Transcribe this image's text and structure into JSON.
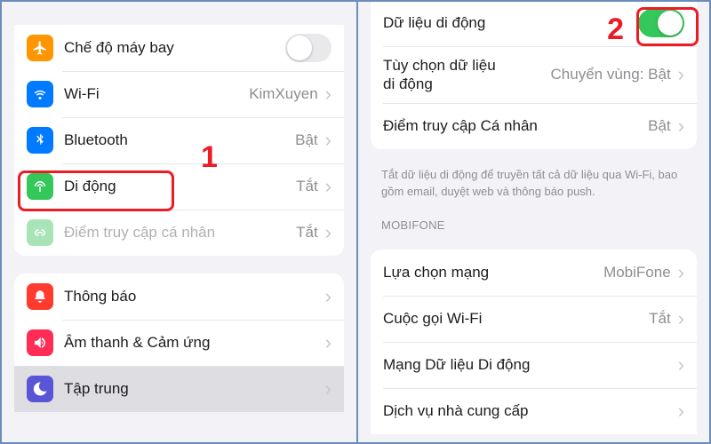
{
  "left": {
    "group1": [
      {
        "id": "airplane",
        "label": "Chế độ máy bay",
        "value": null,
        "toggle": "off",
        "chevron": false
      },
      {
        "id": "wifi",
        "label": "Wi-Fi",
        "value": "KimXuyen",
        "chevron": true
      },
      {
        "id": "bluetooth",
        "label": "Bluetooth",
        "value": "Bật",
        "chevron": true
      },
      {
        "id": "cellular",
        "label": "Di động",
        "value": "Tắt",
        "chevron": true
      },
      {
        "id": "hotspot",
        "label": "Điểm truy cập cá nhân",
        "value": "Tắt",
        "chevron": true,
        "faded": true
      }
    ],
    "group2": [
      {
        "id": "notifications",
        "label": "Thông báo",
        "chevron": true
      },
      {
        "id": "sounds",
        "label": "Âm thanh & Cảm ứng",
        "chevron": true
      },
      {
        "id": "focus",
        "label": "Tập trung",
        "chevron": true,
        "selected": true
      }
    ]
  },
  "right": {
    "group1": [
      {
        "id": "cellular-data",
        "label": "Dữ liệu di động",
        "toggle": "on"
      },
      {
        "id": "data-options",
        "label_line1": "Tùy chọn dữ liệu",
        "label_line2": "di động",
        "value": "Chuyển vùng: Bật",
        "chevron": true
      },
      {
        "id": "personal-hotspot",
        "label": "Điểm truy cập Cá nhân",
        "value": "Bật",
        "chevron": true
      }
    ],
    "group1_footer": "Tắt dữ liệu di động để truyền tất cả dữ liệu qua Wi-Fi, bao gồm email, duyệt web và thông báo push.",
    "carrier_header": "MOBIFONE",
    "group2": [
      {
        "id": "network-selection",
        "label": "Lựa chọn mạng",
        "value": "MobiFone",
        "chevron": true
      },
      {
        "id": "wifi-calling",
        "label": "Cuộc gọi Wi-Fi",
        "value": "Tắt",
        "chevron": true
      },
      {
        "id": "cellular-network",
        "label": "Mạng Dữ liệu Di động",
        "chevron": true
      },
      {
        "id": "carrier-services",
        "label": "Dịch vụ nhà cung cấp",
        "chevron": true
      }
    ]
  },
  "annotations": {
    "step1": "1",
    "step2": "2"
  }
}
